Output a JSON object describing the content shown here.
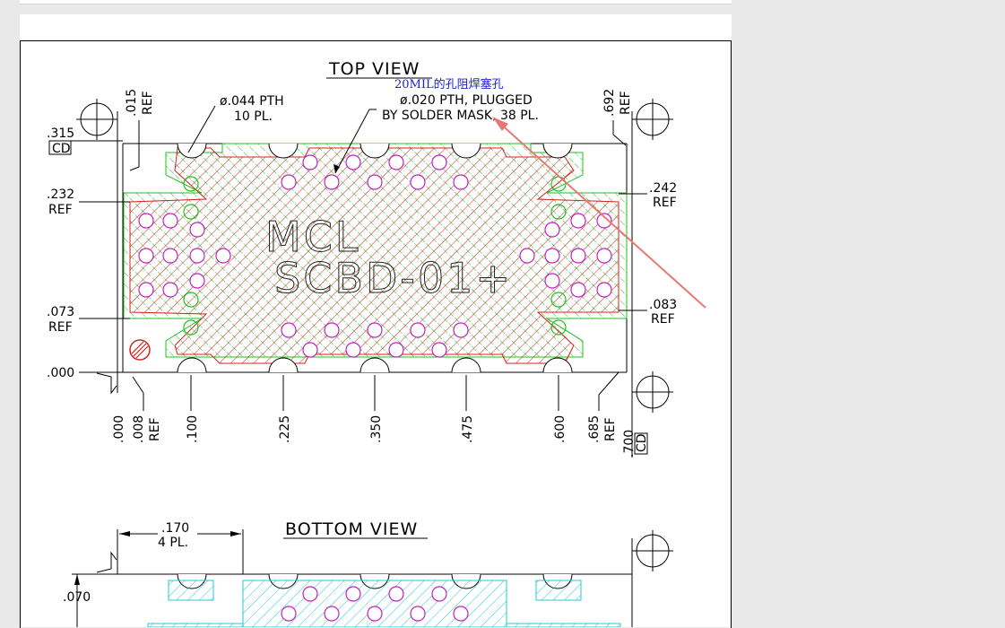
{
  "colors": {
    "copper": "#d42020",
    "mask": "#20c020",
    "via": "#c020c0",
    "bottom": "#20c8d8",
    "annotation": "#2020d0",
    "arrow": "#e87878"
  },
  "top_view": {
    "title": "TOP VIEW",
    "mark_line1": "MCL",
    "mark_line2": "SCBD-01+",
    "callout_pth_dia": "ø.044 PTH",
    "callout_pth_count": "10 PL.",
    "callout_plugged_dia": "ø.020 PTH, PLUGGED",
    "callout_plugged_note": "BY SOLDER MASK, 38 PL.",
    "annotation": "20MIL的孔阻焊塞孔",
    "left_dims": [
      {
        "value": ".315",
        "label": "CD"
      },
      {
        "value": ".232",
        "label": "REF"
      },
      {
        "value": ".073",
        "label": "REF"
      },
      {
        "value": ".000",
        "label": ""
      }
    ],
    "right_dims": [
      {
        "value": ".242",
        "label": "REF"
      },
      {
        "value": ".083",
        "label": "REF"
      }
    ],
    "top_dims": [
      {
        "value": ".015",
        "label": "REF"
      },
      {
        "value": ".692",
        "label": "REF"
      }
    ],
    "bottom_dims": [
      {
        "value": ".000",
        "label": ""
      },
      {
        "value": ".008",
        "label": "REF"
      },
      {
        "value": ".100",
        "label": ""
      },
      {
        "value": ".225",
        "label": ""
      },
      {
        "value": ".350",
        "label": ""
      },
      {
        "value": ".475",
        "label": ""
      },
      {
        "value": ".600",
        "label": ""
      },
      {
        "value": ".685",
        "label": "REF"
      },
      {
        "value": ".700",
        "label": "CD"
      }
    ]
  },
  "bottom_view": {
    "title": "BOTTOM VIEW",
    "pitch_value": ".170",
    "pitch_count": "4 PL.",
    "height_value": ".070"
  }
}
